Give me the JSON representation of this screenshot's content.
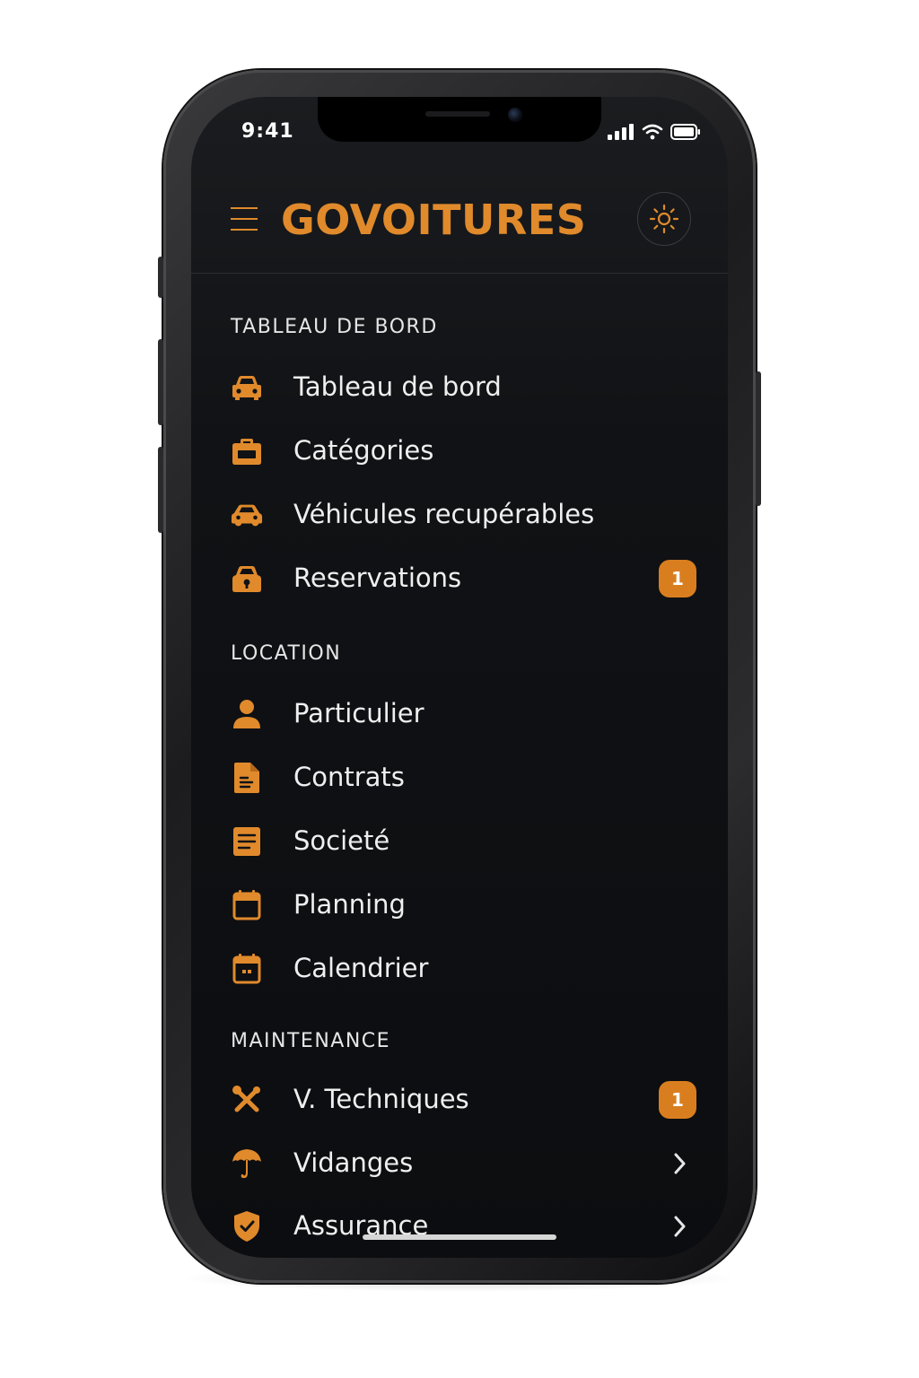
{
  "status_bar": {
    "time": "9:41"
  },
  "header": {
    "brand": "GOVOITURES",
    "menu_icon": "hamburger-icon",
    "theme_icon": "sun-icon"
  },
  "colors": {
    "accent": "#e08a2c",
    "background": "#0c0d10",
    "text": "#efefef",
    "badge": "#d97e1f"
  },
  "menu": {
    "sections": [
      {
        "title": "TABLEAU DE BORD",
        "items": [
          {
            "label": "Tableau de bord",
            "icon": "car-front-icon"
          },
          {
            "label": "Catégories",
            "icon": "briefcase-icon"
          },
          {
            "label": "Véhicules recupérables",
            "icon": "car-icon"
          },
          {
            "label": "Reservations",
            "icon": "car-lock-icon",
            "badge": "1"
          }
        ]
      },
      {
        "title": "LOCATION",
        "items": [
          {
            "label": "Particulier",
            "icon": "person-icon"
          },
          {
            "label": "Contrats",
            "icon": "document-icon"
          },
          {
            "label": "Societé",
            "icon": "notes-icon"
          },
          {
            "label": "Planning",
            "icon": "calendar-icon"
          },
          {
            "label": "Calendrier",
            "icon": "calendar-dates-icon"
          }
        ]
      },
      {
        "title": "MAINTENANCE",
        "items": [
          {
            "label": "V. Techniques",
            "icon": "tools-icon",
            "badge": "1"
          },
          {
            "label": "Vidanges",
            "icon": "umbrella-icon",
            "chevron": "chevron-right-icon"
          },
          {
            "label": "Assurance",
            "icon": "shield-check-icon",
            "chevron": "chevron-right-icon"
          }
        ]
      }
    ]
  }
}
